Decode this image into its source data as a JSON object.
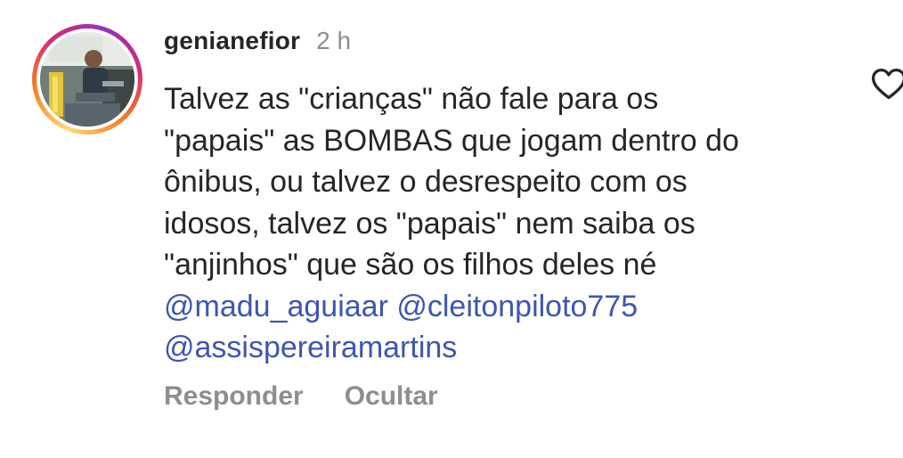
{
  "comment": {
    "username": "genianefior",
    "time": "2 h",
    "lines": [
      "Talvez as \"crianças\" não fale para os",
      "\"papais\" as BOMBAS que jogam dentro do",
      "ônibus, ou talvez o desrespeito com os",
      "idosos, talvez os \"papais\" nem saiba os",
      "\"anjinhos\" que são os filhos deles né"
    ],
    "mentions": [
      "@madu_aguiaar",
      "@cleitonpiloto775",
      "@assispereiramartins"
    ],
    "mention_color": "#3d56b2"
  },
  "actions": {
    "reply_label": "Responder",
    "hide_label": "Ocultar"
  },
  "icons": {
    "like": "heart-outline-icon"
  }
}
